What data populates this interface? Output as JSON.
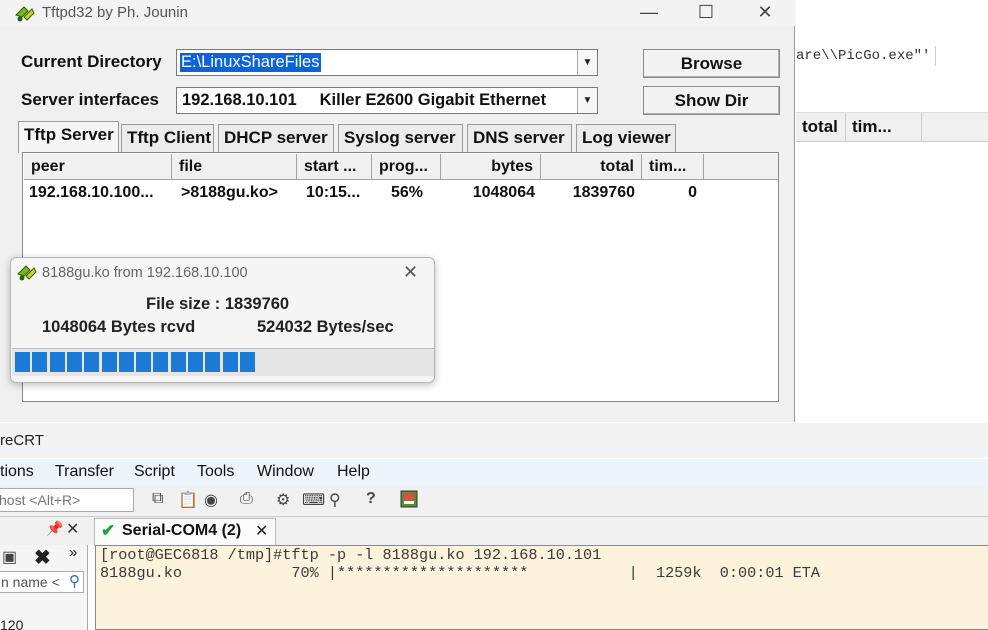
{
  "background_window": {
    "text": "are\\\\PicGo.exe\"'",
    "columns": [
      "total",
      "tim..."
    ]
  },
  "tftp_window": {
    "title": "Tftpd32 by Ph. Jounin",
    "current_directory_label": "Current Directory",
    "current_directory_value": "E:\\LinuxShareFiles",
    "server_interfaces_label": "Server interfaces",
    "server_interfaces_value": "192.168.10.101     Killer E2600 Gigabit Ethernet",
    "browse_label": "Browse",
    "show_dir_label": "Show Dir",
    "tabs": [
      "Tftp Server",
      "Tftp Client",
      "DHCP server",
      "Syslog server",
      "DNS server",
      "Log viewer"
    ],
    "active_tab": "Tftp Server",
    "columns": [
      "peer",
      "file",
      "start ...",
      "prog...",
      "bytes",
      "total",
      "tim..."
    ],
    "rows": [
      {
        "peer": "192.168.10.100...",
        "file": ">8188gu.ko>",
        "start": "10:15...",
        "progress": "56%",
        "bytes": "1048064",
        "total": "1839760",
        "time": "0"
      }
    ]
  },
  "transfer_popup": {
    "title": "8188gu.ko from 192.168.10.100",
    "file_size": "File size : 1839760",
    "bytes_rcvd": "1048064 Bytes rcvd",
    "rate": "524032 Bytes/sec",
    "progress_fraction": 0.57
  },
  "securecrt": {
    "title": "reCRT",
    "menu": [
      "tions",
      "Transfer",
      "Script",
      "Tools",
      "Window",
      "Help"
    ],
    "host_placeholder": "host <Alt+R>",
    "session_tab": "Serial-COM4 (2)",
    "session_filter": "n name <",
    "session_item": "120",
    "terminal_lines": [
      "[root@GEC6818 /tmp]#tftp -p -l 8188gu.ko 192.168.10.101",
      "8188gu.ko            70% |*********************           |  1259k  0:00:01 ETA"
    ]
  },
  "colors": {
    "progress": "#1a7ad6",
    "terminal_bg": "#fdf3dc",
    "selection": "#0a64d8",
    "checkmark": "#22a33a"
  }
}
